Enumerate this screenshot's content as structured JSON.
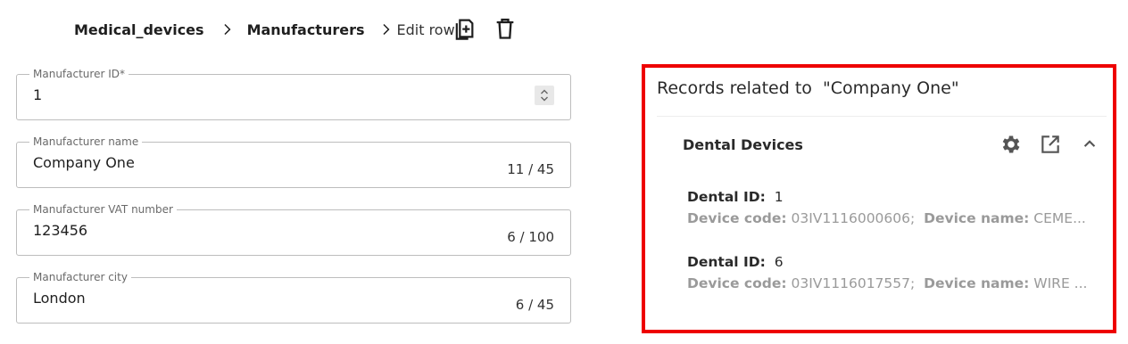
{
  "breadcrumb": {
    "root": "Medical_devices",
    "table": "Manufacturers",
    "current": "Edit row"
  },
  "toolbar": {
    "duplicate_icon": "content-copy-add-icon",
    "delete_icon": "trash-icon"
  },
  "fields": [
    {
      "label": "Manufacturer ID*",
      "value": "1",
      "counter": ""
    },
    {
      "label": "Manufacturer name",
      "value": "Company One",
      "counter": "11 / 45"
    },
    {
      "label": "Manufacturer VAT number",
      "value": "123456",
      "counter": "6 / 100"
    },
    {
      "label": "Manufacturer city",
      "value": "London",
      "counter": "6 / 45"
    }
  ],
  "related": {
    "title": "Records related to  \"Company One\"",
    "card": {
      "title": "Dental Devices",
      "records": [
        {
          "id_label": "Dental ID:",
          "id_value": "1",
          "code_label": "Device code:",
          "code_value": "03IV1116000606;",
          "name_label": "Device name:",
          "name_value": "CEME..."
        },
        {
          "id_label": "Dental ID:",
          "id_value": "6",
          "code_label": "Device code:",
          "code_value": "03IV1116017557;",
          "name_label": "Device name:",
          "name_value": "WIRE ..."
        }
      ]
    }
  },
  "colors": {
    "highlight_border": "#ee0000",
    "muted_text": "#9a9a9a"
  }
}
